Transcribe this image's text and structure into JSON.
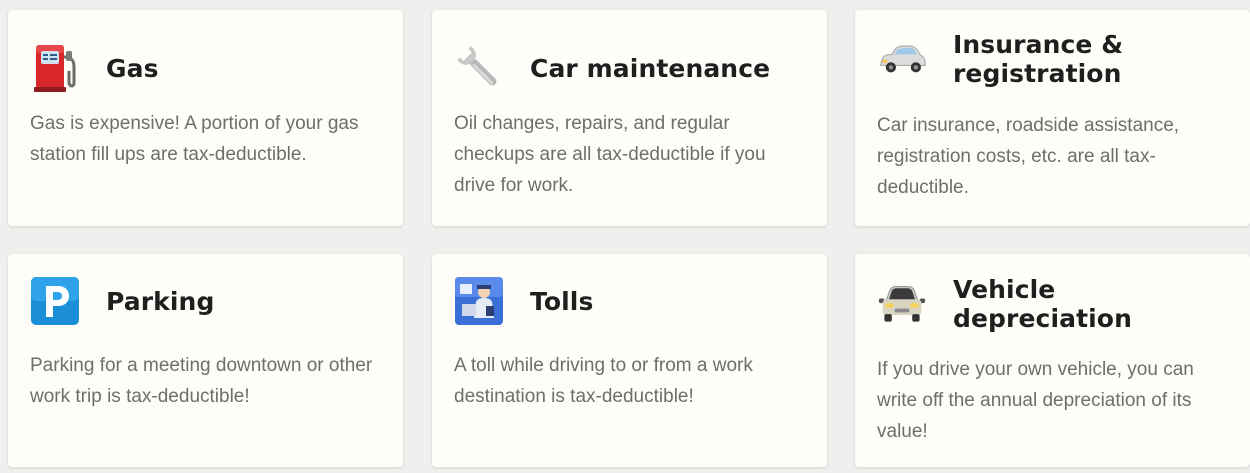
{
  "cards": [
    {
      "title": "Gas",
      "description": "Gas is expensive! A portion of your gas station fill ups are tax-deductible.",
      "icon": "fuel-pump-icon"
    },
    {
      "title": "Car maintenance",
      "description": "Oil changes, repairs, and regular checkups are all tax-deductible if you drive for work.",
      "icon": "wrench-icon"
    },
    {
      "title": "Insurance & registration",
      "description": "Car insurance, roadside assistance, registration costs, etc. are all tax-deductible.",
      "icon": "car-side-icon"
    },
    {
      "title": "Parking",
      "description": "Parking for a meeting downtown or other work trip is tax-deductible!",
      "icon": "parking-sign-icon"
    },
    {
      "title": "Tolls",
      "description": "A toll while driving to or from a work destination is tax-deductible!",
      "icon": "toll-booth-icon"
    },
    {
      "title": "Vehicle depreciation",
      "description": "If you drive your own vehicle, you can write off the annual depreciation of its value!",
      "icon": "car-front-icon"
    }
  ],
  "colors": {
    "background": "#f1efed",
    "card": "#fefdf8",
    "title": "#1f1f1f",
    "body": "#6e6e6e"
  }
}
